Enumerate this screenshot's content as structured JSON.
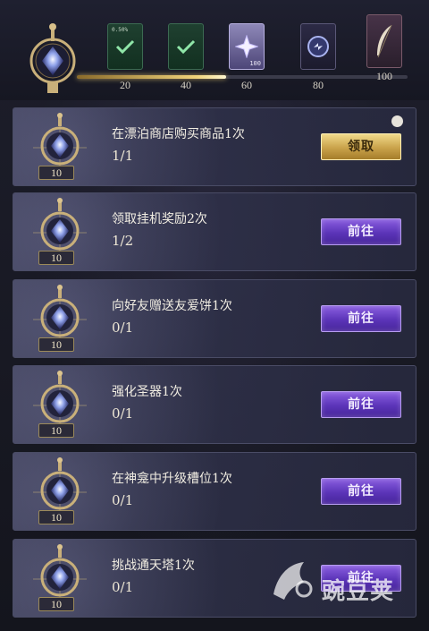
{
  "progress": {
    "fill_fraction": 0.45,
    "milestones": [
      {
        "value": "20",
        "icon": "green-check-card-icon",
        "tag": "0.50%"
      },
      {
        "value": "40",
        "icon": "green-check-card-icon"
      },
      {
        "value": "60",
        "icon": "star-crystal-icon",
        "count": "100"
      },
      {
        "value": "80",
        "icon": "blue-coin-icon"
      },
      {
        "value": "100",
        "icon": "feather-icon"
      }
    ]
  },
  "tasks": [
    {
      "title": "在漂泊商店购买商品1次",
      "progress": "1/1",
      "reward": "10",
      "button": "领取",
      "state": "claim"
    },
    {
      "title": "领取挂机奖励2次",
      "progress": "1/2",
      "reward": "10",
      "button": "前往",
      "state": "go"
    },
    {
      "title": "向好友赠送友爱饼1次",
      "progress": "0/1",
      "reward": "10",
      "button": "前往",
      "state": "go"
    },
    {
      "title": "强化圣器1次",
      "progress": "0/1",
      "reward": "10",
      "button": "前往",
      "state": "go"
    },
    {
      "title": "在神龛中升级槽位1次",
      "progress": "0/1",
      "reward": "10",
      "button": "前往",
      "state": "go"
    },
    {
      "title": "挑战通天塔1次",
      "progress": "0/1",
      "reward": "10",
      "button": "前往",
      "state": "go"
    }
  ],
  "watermark": {
    "text": "豌豆荚"
  },
  "colors": {
    "accent_purple": "#5b34b8",
    "accent_gold": "#c9a24a"
  }
}
